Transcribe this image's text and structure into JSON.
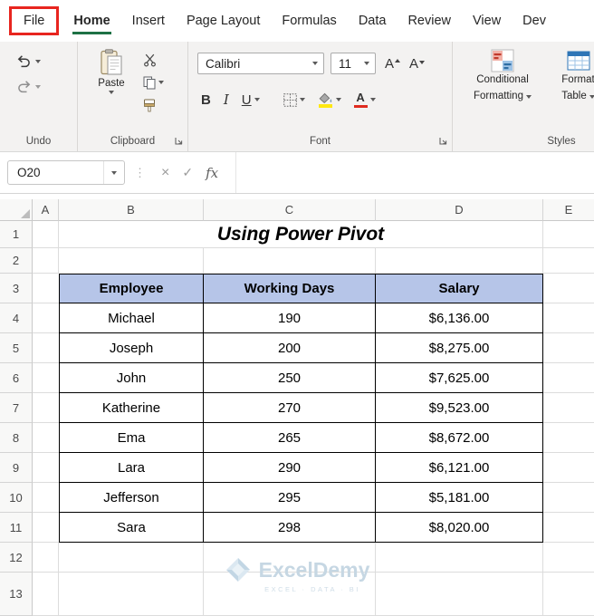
{
  "tabs": {
    "file": "File",
    "home": "Home",
    "insert": "Insert",
    "page_layout": "Page Layout",
    "formulas": "Formulas",
    "data": "Data",
    "review": "Review",
    "view": "View",
    "developer": "Dev"
  },
  "ribbon": {
    "undo_group": "Undo",
    "clipboard_group": "Clipboard",
    "paste": "Paste",
    "font_group": "Font",
    "font_name": "Calibri",
    "font_size": "11",
    "bold": "B",
    "italic": "I",
    "underline": "U",
    "grow_font": "A",
    "shrink_font": "A",
    "styles_group": "Styles",
    "conditional_1": "Conditional",
    "conditional_2": "Formatting",
    "format_table_1": "Format",
    "format_table_2": "Table"
  },
  "formula_bar": {
    "name_box": "O20",
    "cancel": "×",
    "enter": "✓",
    "fx": "fx",
    "dots": "⋮",
    "formula": ""
  },
  "sheet": {
    "columns": [
      "A",
      "B",
      "C",
      "D",
      "E"
    ],
    "row_numbers": [
      "1",
      "2",
      "3",
      "4",
      "5",
      "6",
      "7",
      "8",
      "9",
      "10",
      "11",
      "12",
      "13"
    ],
    "title": "Using Power Pivot"
  },
  "table": {
    "headers": [
      "Employee",
      "Working Days",
      "Salary"
    ],
    "rows": [
      [
        "Michael",
        "190",
        "$6,136.00"
      ],
      [
        "Joseph",
        "200",
        "$8,275.00"
      ],
      [
        "John",
        "250",
        "$7,625.00"
      ],
      [
        "Katherine",
        "270",
        "$9,523.00"
      ],
      [
        "Ema",
        "265",
        "$8,672.00"
      ],
      [
        "Lara",
        "290",
        "$6,121.00"
      ],
      [
        "Jefferson",
        "295",
        "$5,181.00"
      ],
      [
        "Sara",
        "298",
        "$8,020.00"
      ]
    ]
  },
  "watermark": {
    "brand": "ExcelDemy",
    "tagline": "EXCEL · DATA · BI"
  },
  "colors": {
    "excel_green": "#1e7145",
    "table_header_fill": "#b6c5e8",
    "file_box_red": "#e8251f",
    "highlight_yellow": "#ffe812",
    "font_color_red": "#e02b20"
  }
}
